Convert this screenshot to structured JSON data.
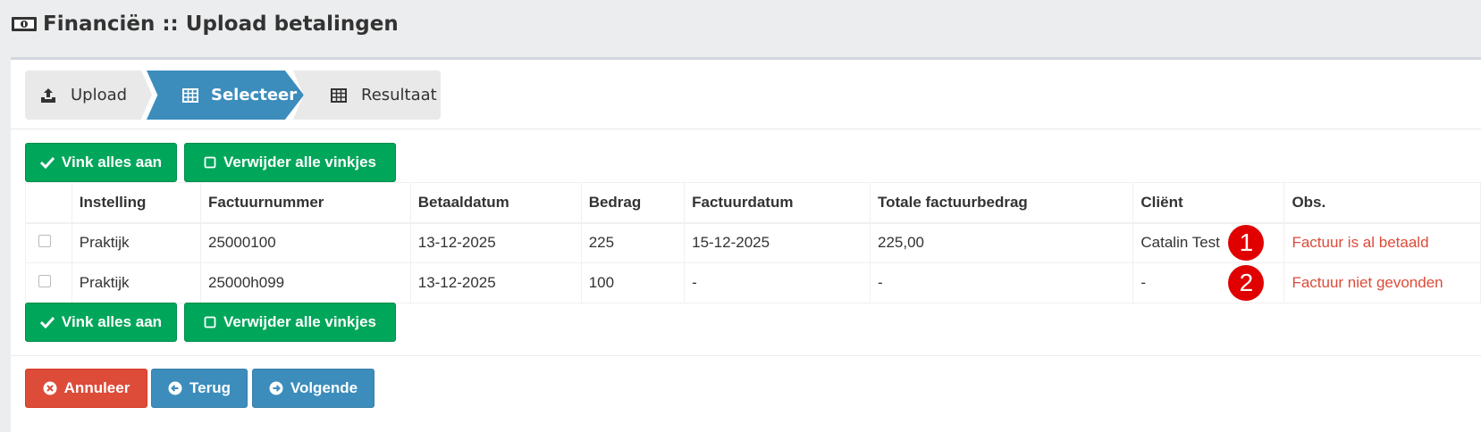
{
  "header": {
    "icon": "money-bill-icon",
    "title": "Financiën :: Upload betalingen"
  },
  "wizard": {
    "steps": [
      {
        "label": "Upload",
        "icon": "upload-icon",
        "active": false
      },
      {
        "label": "Selecteer",
        "icon": "table-icon",
        "active": true
      },
      {
        "label": "Resultaat",
        "icon": "table-icon",
        "active": false
      }
    ]
  },
  "selection_actions": {
    "check_all": "Vink alles aan",
    "uncheck_all": "Verwijder alle vinkjes"
  },
  "table": {
    "columns": [
      "",
      "Instelling",
      "Factuurnummer",
      "Betaaldatum",
      "Bedrag",
      "Factuurdatum",
      "Totale factuurbedrag",
      "Cliënt",
      "Obs."
    ],
    "rows": [
      {
        "instelling": "Praktijk",
        "factuurnummer": "25000100",
        "betaaldatum": "13-12-2025",
        "bedrag": "225",
        "factuurdatum": "15-12-2025",
        "totaal": "225,00",
        "client": "Catalin Test",
        "marker": "1",
        "obs": "Factuur is al betaald",
        "checked": false
      },
      {
        "instelling": "Praktijk",
        "factuurnummer": "25000h099",
        "betaaldatum": "13-12-2025",
        "bedrag": "100",
        "factuurdatum": "-",
        "totaal": "-",
        "client": "-",
        "marker": "2",
        "obs": "Factuur niet gevonden",
        "checked": false
      }
    ]
  },
  "footer": {
    "cancel": "Annuleer",
    "back": "Terug",
    "next": "Volgende"
  },
  "colors": {
    "green": "#00a65a",
    "blue": "#3c8dbc",
    "red": "#dd4b39",
    "marker": "#e00000"
  }
}
